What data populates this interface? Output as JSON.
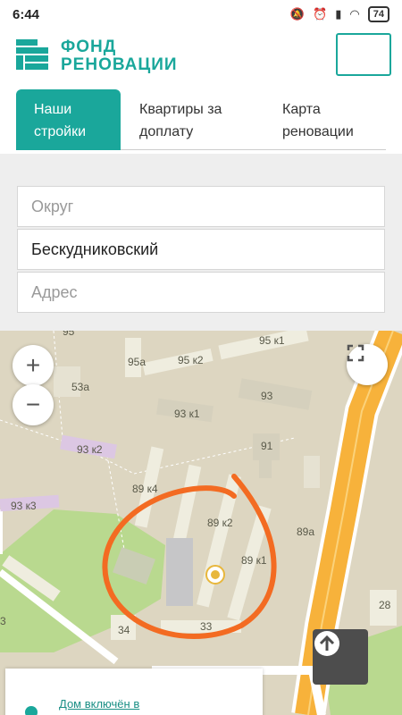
{
  "status": {
    "time": "6:44",
    "battery": "74"
  },
  "header": {
    "logo_line1": "ФОНД",
    "logo_line2": "РЕНОВАЦИИ"
  },
  "tabs": [
    {
      "line1": "Наши",
      "line2": "стройки"
    },
    {
      "line1": "Квартиры за",
      "line2": "доплату"
    },
    {
      "line1": "Карта",
      "line2": "реновации"
    }
  ],
  "filters": {
    "district_placeholder": "Округ",
    "area_value": "Бескудниковский",
    "address_placeholder": "Адрес"
  },
  "map": {
    "zoom_in": "+",
    "zoom_out": "−",
    "labels": [
      "95",
      "95 к1",
      "95а",
      "95 к2",
      "53а",
      "93",
      "93 к1",
      "93 к2",
      "91",
      "89 к4",
      "93 к3",
      "89 к2",
      "89а",
      "89 к1",
      "28",
      "34",
      "33",
      "3"
    ],
    "info_link": "Дом включён в"
  },
  "colors": {
    "accent": "#1aa79b",
    "highlight_circle": "#f36b22",
    "road": "#f7b23b"
  }
}
